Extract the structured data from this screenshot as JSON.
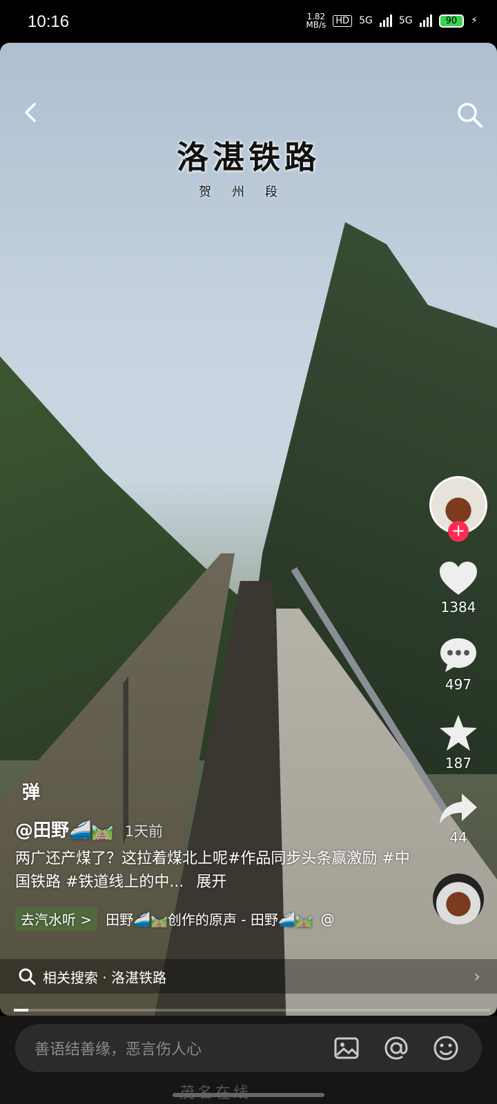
{
  "status_bar": {
    "time": "10:16",
    "net_speed_value": "1.82",
    "net_speed_unit": "MB/s",
    "hd_badge": "HD",
    "signal1": "5G",
    "signal2": "5G",
    "battery": "90"
  },
  "video": {
    "title_overlay": "洛湛铁路",
    "subtitle_overlay": "贺州段"
  },
  "actions": {
    "like_count": "1384",
    "comment_count": "497",
    "favorite_count": "187",
    "share_count": "44",
    "follow_symbol": "+"
  },
  "info": {
    "danmaku_label": "弹",
    "author": "@田野🚄🛤️",
    "time_ago": "1天前",
    "description": "两广还产煤了？这拉着煤北上呢#作品同步头条赢激励 #中国铁路 #铁道线上的中...",
    "expand_label": "展开",
    "music_tag": "去汽水听 >",
    "music_text": "田野🚄🛤️创作的原声 - 田野🚄🛤️",
    "music_at": "@"
  },
  "related": {
    "label": "相关搜索 · 洛湛铁路",
    "arrow": "›"
  },
  "progress": 0.03,
  "comment_bar": {
    "placeholder": "善语结善缘，恶言伤人心"
  },
  "watermark": "茂名在线"
}
